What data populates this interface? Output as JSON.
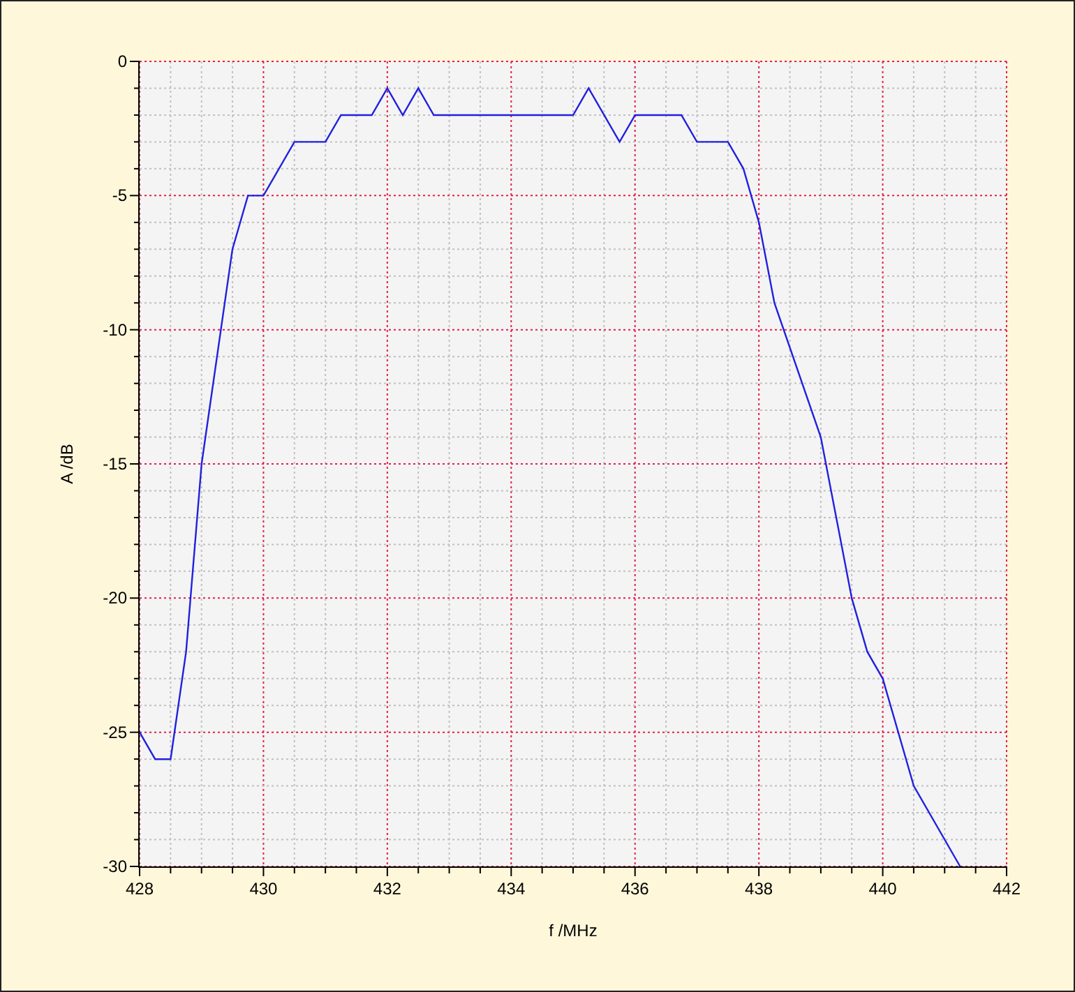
{
  "chart_data": {
    "type": "line",
    "xlabel": "f /MHz",
    "ylabel": "A /dB",
    "x": [
      428,
      428.25,
      428.5,
      428.75,
      429,
      429.5,
      429.75,
      430,
      430.5,
      431,
      431.25,
      431.75,
      432,
      432.25,
      432.5,
      432.75,
      435,
      435.25,
      435.75,
      436,
      436.75,
      437,
      437.5,
      437.75,
      438,
      438.25,
      439,
      439.25,
      439.5,
      439.75,
      440,
      440.5,
      441.25
    ],
    "series": [
      {
        "color": "#2020e0",
        "values": [
          -25,
          -26,
          -26,
          -22,
          -15,
          -7,
          -5,
          -5,
          -3,
          -3,
          -2,
          -2,
          -1,
          -2,
          -1,
          -2,
          -2,
          -1,
          -3,
          -2,
          -2,
          -3,
          -3,
          -4,
          -6,
          -9,
          -14,
          -17,
          -20,
          -22,
          -23,
          -27,
          -30
        ]
      }
    ],
    "xlim": [
      428,
      442
    ],
    "ylim": [
      -30,
      0
    ],
    "xticks": [
      428,
      430,
      432,
      434,
      436,
      438,
      440,
      442
    ],
    "yticks": [
      -30,
      -25,
      -20,
      -15,
      -10,
      -5,
      0
    ],
    "grid": true
  }
}
